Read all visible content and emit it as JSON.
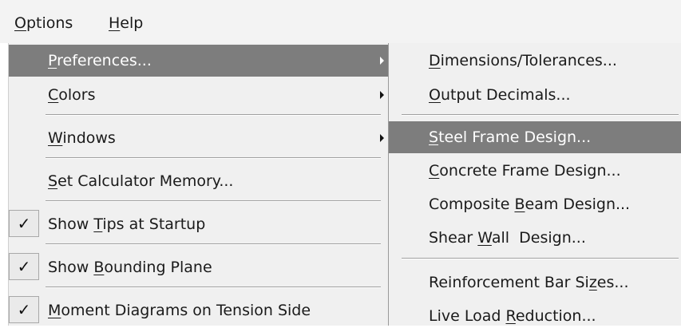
{
  "menubar": {
    "options": {
      "pre": "",
      "key": "O",
      "post": "ptions"
    },
    "help": {
      "pre": "",
      "key": "H",
      "post": "elp"
    }
  },
  "main_menu": {
    "preferences": {
      "pre": "",
      "key": "P",
      "post": "references..."
    },
    "colors": {
      "pre": "",
      "key": "C",
      "post": "olors"
    },
    "windows": {
      "pre": "",
      "key": "W",
      "post": "indows"
    },
    "set_calculator_memory": {
      "pre": "",
      "key": "S",
      "post": "et Calculator Memory..."
    },
    "show_tips": {
      "pre": "Show ",
      "key": "T",
      "post": "ips at Startup",
      "checked": true
    },
    "show_bounding_plane": {
      "pre": "Show ",
      "key": "B",
      "post": "ounding Plane",
      "checked": true
    },
    "moment_diagrams": {
      "pre": "",
      "key": "M",
      "post": "oment Diagrams on Tension Side",
      "checked": true
    },
    "check_glyph": "✓"
  },
  "sub_menu": {
    "dimensions": {
      "pre": "",
      "key": "D",
      "post": "imensions/Tolerances..."
    },
    "output_decimals": {
      "pre": "",
      "key": "O",
      "post": "utput Decimals..."
    },
    "steel_frame": {
      "pre": "",
      "key": "S",
      "post": "teel Frame Design..."
    },
    "concrete_frame": {
      "pre": "",
      "key": "C",
      "post": "oncrete Frame Design..."
    },
    "composite_beam": {
      "pre": "Composite ",
      "key": "B",
      "post": "eam Design..."
    },
    "shear_wall": {
      "pre": "Shear ",
      "key": "W",
      "post": "all  Design..."
    },
    "reinforcement_bar": {
      "pre": "Reinforcement Bar Si",
      "key": "z",
      "post": "es..."
    },
    "live_load": {
      "pre": "Live Load ",
      "key": "R",
      "post": "eduction..."
    }
  },
  "colors": {
    "menubar_bg": "#f3f3f3",
    "menu_bg": "#f0f0f0",
    "highlight_bg": "#7d7d7d",
    "highlight_text": "#ffffff"
  }
}
